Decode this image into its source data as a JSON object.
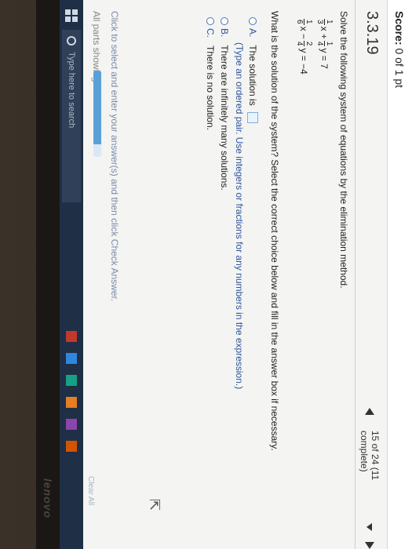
{
  "header": {
    "score_label": "Score:",
    "score_value": "0 of 1 pt",
    "problem_number": "3.3.19",
    "progress_text": "15 of 24 (11 complete)"
  },
  "problem": {
    "instructions": "Solve the following system of equations by the elimination method.",
    "eq1": {
      "a_num": "1",
      "a_den": "3",
      "var1": "x +",
      "b_num": "1",
      "b_den": "4",
      "var2": "y = 7"
    },
    "eq2": {
      "a_num": "1",
      "a_den": "6",
      "var1": "x −",
      "b_num": "2",
      "b_den": "4",
      "var2": "y = −4"
    },
    "question": "What is the solution of the system? Select the correct choice below and fill in the answer box if necessary."
  },
  "choices": [
    {
      "letter": "A.",
      "text": "The solution is"
    },
    {
      "letter": "B.",
      "text": "There are infinitely many solutions."
    },
    {
      "letter": "C.",
      "text": "There is no solution."
    }
  ],
  "hint": "(Type an ordered pair. Use integers or fractions for any numbers in the expression.)",
  "footer": {
    "instruction": "Click to select and enter your answer(s) and then click Check Answer.",
    "parts_label": "All parts showing",
    "progress_fraction": 0.85,
    "clear_label": "Clear All"
  },
  "taskbar": {
    "search_placeholder": "Type here to search",
    "app_colors": [
      "#c0392b",
      "#2e86de",
      "#16a085",
      "#e67e22",
      "#8e44ad",
      "#d35400"
    ]
  },
  "brand": "lenovo",
  "colors": {
    "accent": "#2a55a0",
    "taskbar": "#1f2f45",
    "progress": "#5aa0d8"
  }
}
